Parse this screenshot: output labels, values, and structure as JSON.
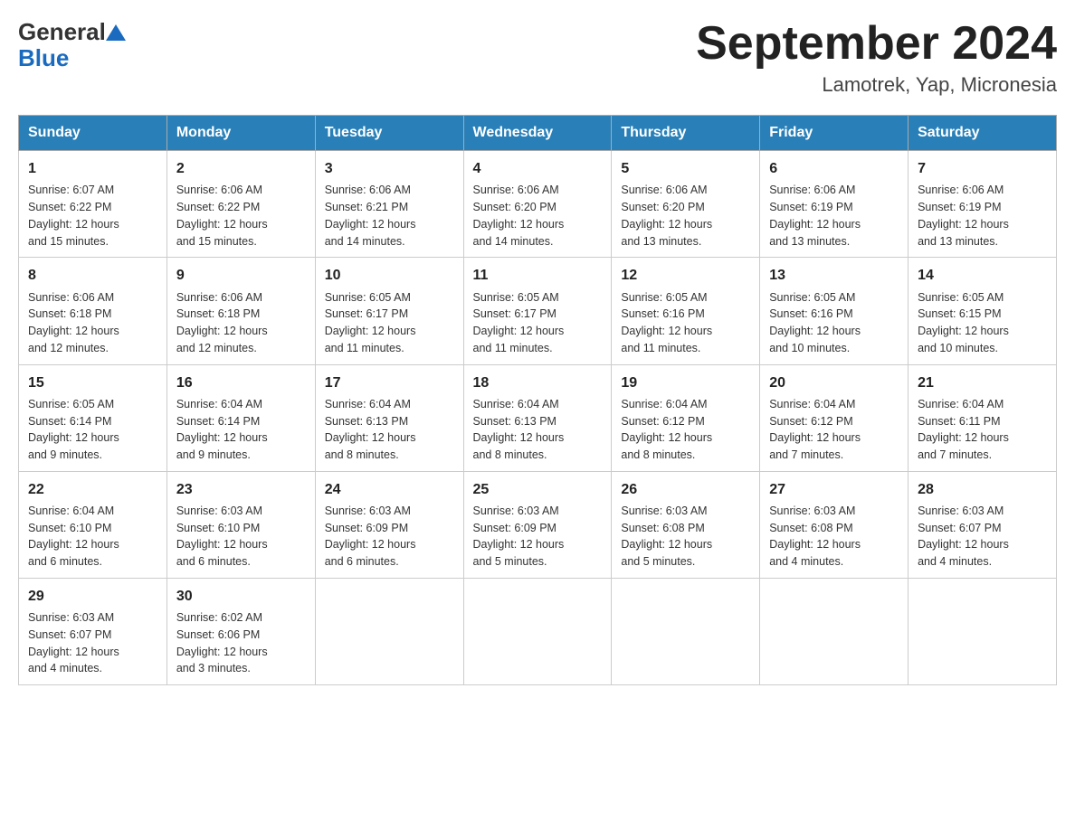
{
  "header": {
    "logo_general": "General",
    "logo_blue": "Blue",
    "month_title": "September 2024",
    "location": "Lamotrek, Yap, Micronesia"
  },
  "days_of_week": [
    "Sunday",
    "Monday",
    "Tuesday",
    "Wednesday",
    "Thursday",
    "Friday",
    "Saturday"
  ],
  "weeks": [
    [
      {
        "day": "1",
        "info": "Sunrise: 6:07 AM\nSunset: 6:22 PM\nDaylight: 12 hours\nand 15 minutes."
      },
      {
        "day": "2",
        "info": "Sunrise: 6:06 AM\nSunset: 6:22 PM\nDaylight: 12 hours\nand 15 minutes."
      },
      {
        "day": "3",
        "info": "Sunrise: 6:06 AM\nSunset: 6:21 PM\nDaylight: 12 hours\nand 14 minutes."
      },
      {
        "day": "4",
        "info": "Sunrise: 6:06 AM\nSunset: 6:20 PM\nDaylight: 12 hours\nand 14 minutes."
      },
      {
        "day": "5",
        "info": "Sunrise: 6:06 AM\nSunset: 6:20 PM\nDaylight: 12 hours\nand 13 minutes."
      },
      {
        "day": "6",
        "info": "Sunrise: 6:06 AM\nSunset: 6:19 PM\nDaylight: 12 hours\nand 13 minutes."
      },
      {
        "day": "7",
        "info": "Sunrise: 6:06 AM\nSunset: 6:19 PM\nDaylight: 12 hours\nand 13 minutes."
      }
    ],
    [
      {
        "day": "8",
        "info": "Sunrise: 6:06 AM\nSunset: 6:18 PM\nDaylight: 12 hours\nand 12 minutes."
      },
      {
        "day": "9",
        "info": "Sunrise: 6:06 AM\nSunset: 6:18 PM\nDaylight: 12 hours\nand 12 minutes."
      },
      {
        "day": "10",
        "info": "Sunrise: 6:05 AM\nSunset: 6:17 PM\nDaylight: 12 hours\nand 11 minutes."
      },
      {
        "day": "11",
        "info": "Sunrise: 6:05 AM\nSunset: 6:17 PM\nDaylight: 12 hours\nand 11 minutes."
      },
      {
        "day": "12",
        "info": "Sunrise: 6:05 AM\nSunset: 6:16 PM\nDaylight: 12 hours\nand 11 minutes."
      },
      {
        "day": "13",
        "info": "Sunrise: 6:05 AM\nSunset: 6:16 PM\nDaylight: 12 hours\nand 10 minutes."
      },
      {
        "day": "14",
        "info": "Sunrise: 6:05 AM\nSunset: 6:15 PM\nDaylight: 12 hours\nand 10 minutes."
      }
    ],
    [
      {
        "day": "15",
        "info": "Sunrise: 6:05 AM\nSunset: 6:14 PM\nDaylight: 12 hours\nand 9 minutes."
      },
      {
        "day": "16",
        "info": "Sunrise: 6:04 AM\nSunset: 6:14 PM\nDaylight: 12 hours\nand 9 minutes."
      },
      {
        "day": "17",
        "info": "Sunrise: 6:04 AM\nSunset: 6:13 PM\nDaylight: 12 hours\nand 8 minutes."
      },
      {
        "day": "18",
        "info": "Sunrise: 6:04 AM\nSunset: 6:13 PM\nDaylight: 12 hours\nand 8 minutes."
      },
      {
        "day": "19",
        "info": "Sunrise: 6:04 AM\nSunset: 6:12 PM\nDaylight: 12 hours\nand 8 minutes."
      },
      {
        "day": "20",
        "info": "Sunrise: 6:04 AM\nSunset: 6:12 PM\nDaylight: 12 hours\nand 7 minutes."
      },
      {
        "day": "21",
        "info": "Sunrise: 6:04 AM\nSunset: 6:11 PM\nDaylight: 12 hours\nand 7 minutes."
      }
    ],
    [
      {
        "day": "22",
        "info": "Sunrise: 6:04 AM\nSunset: 6:10 PM\nDaylight: 12 hours\nand 6 minutes."
      },
      {
        "day": "23",
        "info": "Sunrise: 6:03 AM\nSunset: 6:10 PM\nDaylight: 12 hours\nand 6 minutes."
      },
      {
        "day": "24",
        "info": "Sunrise: 6:03 AM\nSunset: 6:09 PM\nDaylight: 12 hours\nand 6 minutes."
      },
      {
        "day": "25",
        "info": "Sunrise: 6:03 AM\nSunset: 6:09 PM\nDaylight: 12 hours\nand 5 minutes."
      },
      {
        "day": "26",
        "info": "Sunrise: 6:03 AM\nSunset: 6:08 PM\nDaylight: 12 hours\nand 5 minutes."
      },
      {
        "day": "27",
        "info": "Sunrise: 6:03 AM\nSunset: 6:08 PM\nDaylight: 12 hours\nand 4 minutes."
      },
      {
        "day": "28",
        "info": "Sunrise: 6:03 AM\nSunset: 6:07 PM\nDaylight: 12 hours\nand 4 minutes."
      }
    ],
    [
      {
        "day": "29",
        "info": "Sunrise: 6:03 AM\nSunset: 6:07 PM\nDaylight: 12 hours\nand 4 minutes."
      },
      {
        "day": "30",
        "info": "Sunrise: 6:02 AM\nSunset: 6:06 PM\nDaylight: 12 hours\nand 3 minutes."
      },
      {
        "day": "",
        "info": ""
      },
      {
        "day": "",
        "info": ""
      },
      {
        "day": "",
        "info": ""
      },
      {
        "day": "",
        "info": ""
      },
      {
        "day": "",
        "info": ""
      }
    ]
  ]
}
